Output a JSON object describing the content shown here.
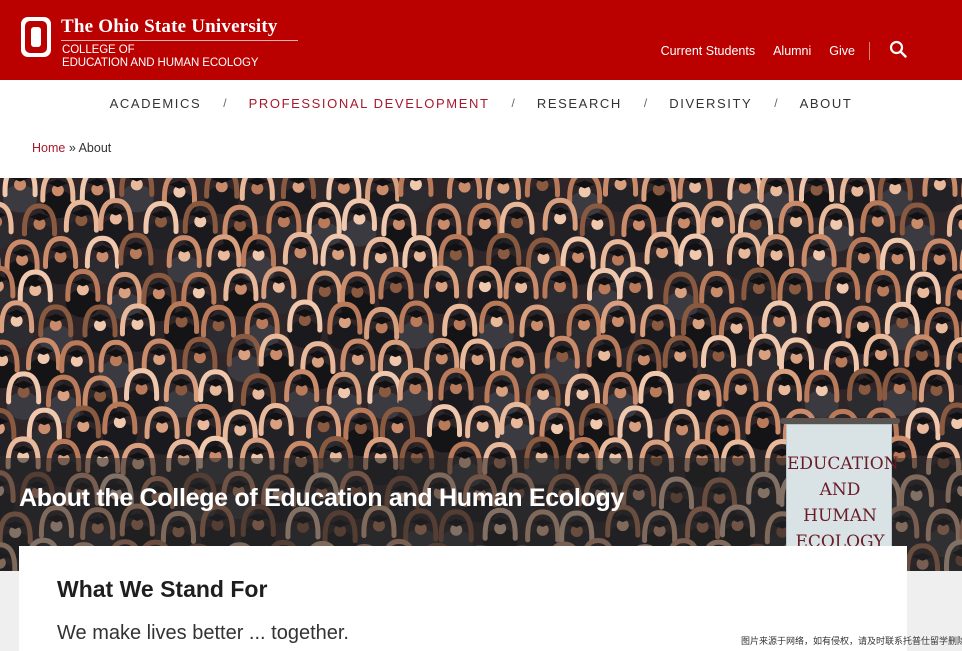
{
  "header": {
    "university_name": "The Ohio State University",
    "college_line_1": "COLLEGE OF",
    "college_line_2": "EDUCATION AND HUMAN ECOLOGY",
    "utility_links": [
      "Current Students",
      "Alumni",
      "Give"
    ],
    "search_icon": "search-icon",
    "logo_icon": "block-o-logo-icon"
  },
  "nav": {
    "items": [
      "ACADEMICS",
      "PROFESSIONAL DEVELOPMENT",
      "RESEARCH",
      "DIVERSITY",
      "ABOUT"
    ],
    "separator": "/",
    "active": "PROFESSIONAL DEVELOPMENT"
  },
  "breadcrumb": {
    "home": "Home",
    "separator": "»",
    "current": "About"
  },
  "hero": {
    "title": "About the College of Education and Human Ecology",
    "banner_lines": [
      "EDUCATION",
      "AND",
      "HUMAN",
      "ECOLOGY"
    ]
  },
  "card": {
    "heading": "What We Stand For",
    "subtitle": "We make lives better ... together."
  },
  "watermark": "图片来源于网络，如有侵权，请及时联系托普仕留学删除",
  "colors": {
    "brand_red": "#bb0000",
    "link_red": "#a6192e",
    "text_dark": "#333333"
  }
}
